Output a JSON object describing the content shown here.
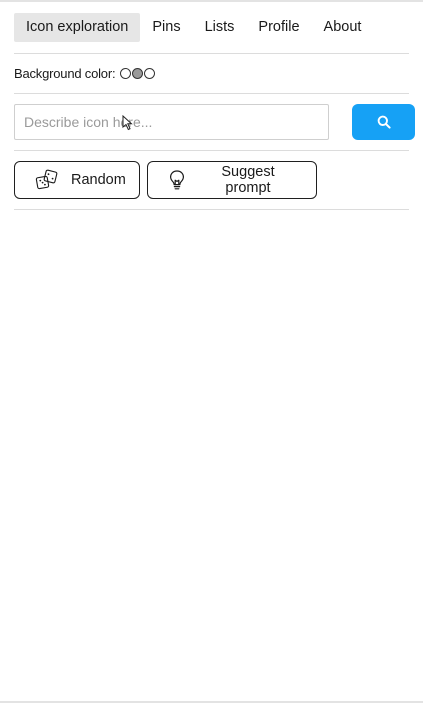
{
  "nav": {
    "tabs": [
      {
        "label": "Icon exploration",
        "active": true
      },
      {
        "label": "Pins",
        "active": false
      },
      {
        "label": "Lists",
        "active": false
      },
      {
        "label": "Profile",
        "active": false
      },
      {
        "label": "About",
        "active": false
      }
    ]
  },
  "background": {
    "label": "Background color:",
    "swatches": [
      {
        "name": "white",
        "color": "#ffffff"
      },
      {
        "name": "gray",
        "color": "#9a9a9a"
      },
      {
        "name": "white-alt",
        "color": "#ffffff"
      }
    ]
  },
  "search": {
    "placeholder": "Describe icon here...",
    "value": "",
    "button_icon": "search-icon",
    "button_color": "#16a1f5"
  },
  "actions": {
    "random_label": "Random",
    "random_icon": "dice-icon",
    "suggest_label": "Suggest prompt",
    "suggest_icon": "lightbulb-icon"
  }
}
